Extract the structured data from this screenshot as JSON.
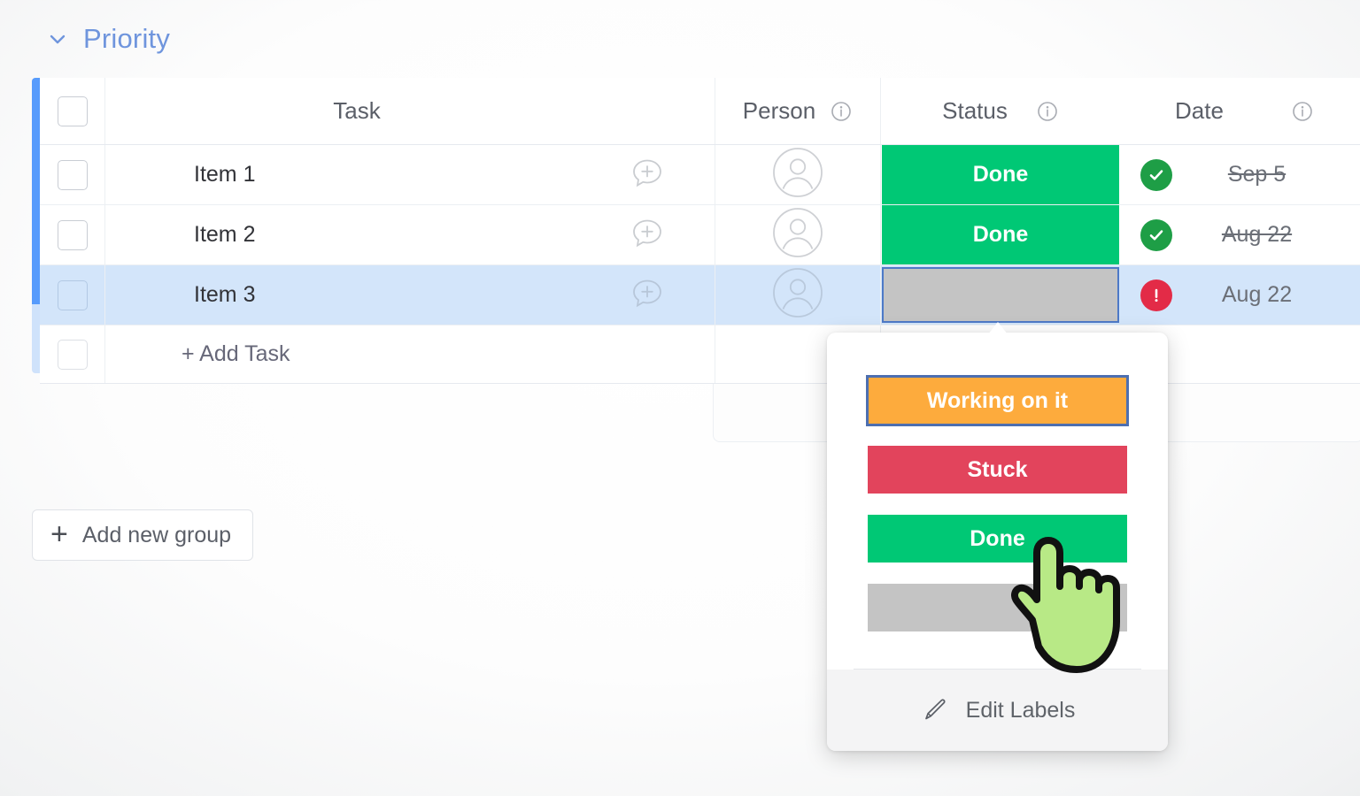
{
  "group": {
    "title": "Priority",
    "collapse_icon": "chevron-down-icon",
    "accent_color": "#579bfc",
    "title_color": "#6f95dd"
  },
  "table": {
    "columns": [
      {
        "key": "task",
        "label": "Task",
        "info_icon": false
      },
      {
        "key": "person",
        "label": "Person",
        "info_icon": true
      },
      {
        "key": "status",
        "label": "Status",
        "info_icon": true
      },
      {
        "key": "date",
        "label": "Date",
        "info_icon": true
      }
    ],
    "rows": [
      {
        "task": "Item 1",
        "person": "",
        "person_icon": "person-avatar-icon",
        "comment_icon": "add-comment-icon",
        "status": {
          "label": "Done",
          "color": "#00c875",
          "empty": false
        },
        "date": {
          "text": "Sep 5",
          "strikethrough": true,
          "badge": "check-circle-icon",
          "badge_color": "#1e9e46"
        },
        "selected": false
      },
      {
        "task": "Item 2",
        "person": "",
        "person_icon": "person-avatar-icon",
        "comment_icon": "add-comment-icon",
        "status": {
          "label": "Done",
          "color": "#00c875",
          "empty": false
        },
        "date": {
          "text": "Aug 22",
          "strikethrough": true,
          "badge": "check-circle-icon",
          "badge_color": "#1e9e46"
        },
        "selected": false
      },
      {
        "task": "Item 3",
        "person": "",
        "person_icon": "person-avatar-icon",
        "comment_icon": "add-comment-icon",
        "status": {
          "label": "",
          "color": "#c4c4c4",
          "empty": true
        },
        "date": {
          "text": "Aug 22",
          "strikethrough": false,
          "badge": "alert-circle-icon",
          "badge_color": "#e32b47"
        },
        "selected": true
      }
    ],
    "add_task_label": "+ Add Task",
    "selected_row_color": "#d3e5fa"
  },
  "add_group_button": {
    "label": "Add new group",
    "icon": "plus-icon"
  },
  "status_dropdown": {
    "options": [
      {
        "label": "Working on it",
        "color": "#fdab3d",
        "focused": true
      },
      {
        "label": "Stuck",
        "color": "#e2445c",
        "focused": false
      },
      {
        "label": "Done",
        "color": "#00c875",
        "focused": false
      },
      {
        "label": "",
        "color": "#c4c4c4",
        "focused": false
      }
    ],
    "footer": {
      "label": "Edit Labels",
      "icon": "pencil-icon"
    }
  },
  "cursor": {
    "icon": "pointing-hand-cursor",
    "fill": "#b8e986"
  }
}
